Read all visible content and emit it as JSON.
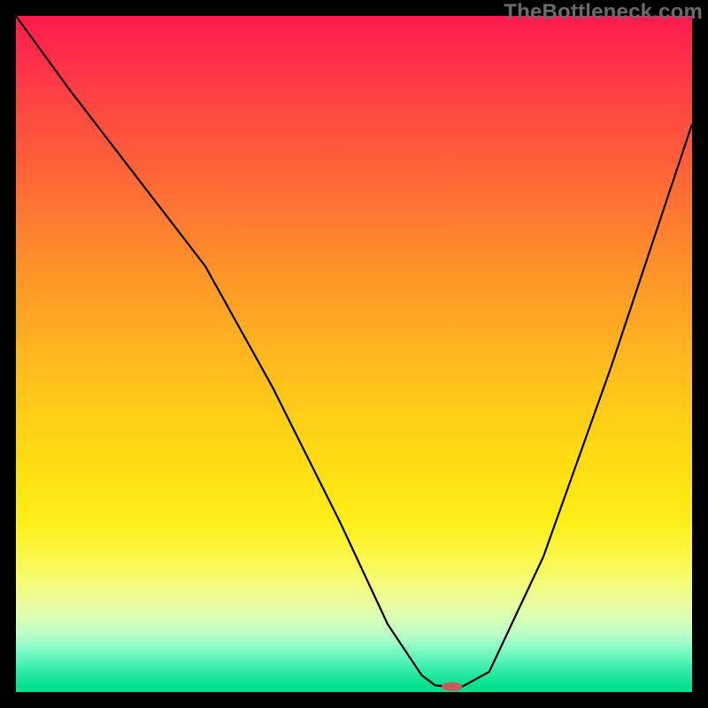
{
  "watermark": "TheBottleneck.com",
  "chart_data": {
    "type": "line",
    "title": "",
    "xlabel": "",
    "ylabel": "",
    "xlim": [
      0,
      100
    ],
    "ylim": [
      0,
      100
    ],
    "grid": false,
    "legend": false,
    "series": [
      {
        "name": "bottleneck-curve",
        "x": [
          0,
          8,
          18,
          28,
          38,
          48,
          55,
          60,
          62,
          64,
          66,
          70,
          78,
          88,
          98,
          100
        ],
        "values": [
          100,
          89,
          76,
          63,
          45,
          25,
          10,
          2.5,
          1,
          0.8,
          0.8,
          3,
          20,
          48,
          78,
          84
        ]
      }
    ],
    "marker": {
      "name": "optimal-point",
      "x": 64.5,
      "y": 0.8,
      "fill": "#c85a5a",
      "rx": 12,
      "ry": 5
    },
    "gradient_stops": [
      {
        "pos": 0,
        "color": "#ff1b4f"
      },
      {
        "pos": 50,
        "color": "#ffc61a"
      },
      {
        "pos": 80,
        "color": "#fff94d"
      },
      {
        "pos": 100,
        "color": "#00dd8c"
      }
    ]
  }
}
